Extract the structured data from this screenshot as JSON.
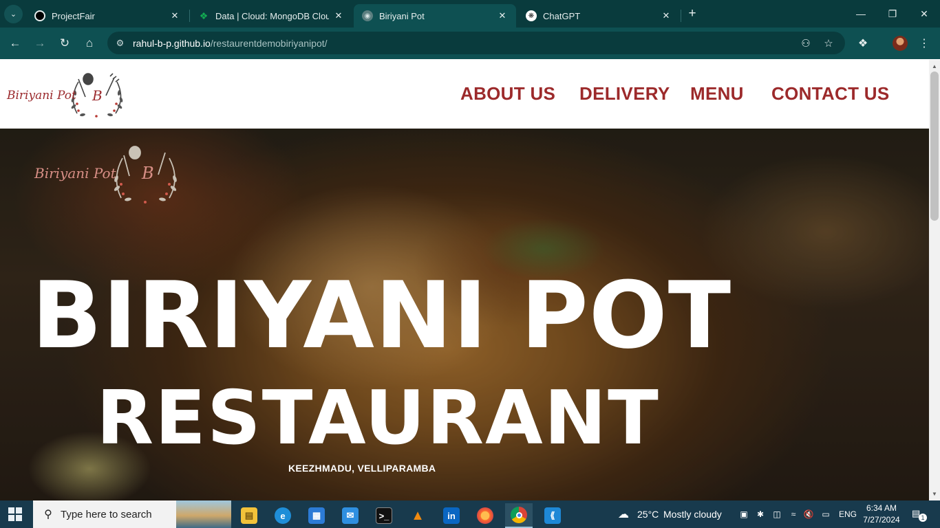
{
  "browser": {
    "tabs": [
      {
        "label": "ProjectFair",
        "icon": "github-icon"
      },
      {
        "label": "Data | Cloud: MongoDB Cloud",
        "icon": "mongodb-leaf-icon"
      },
      {
        "label": "Biriyani Pot",
        "icon": "site-favicon-icon"
      },
      {
        "label": "ChatGPT",
        "icon": "openai-icon"
      }
    ],
    "active_tab_index": 2,
    "url_host": "rahul-b-p.github.io",
    "url_path": "/restaurentdemobiriyanipot/"
  },
  "site": {
    "logo_text": "Biriyani Pot",
    "logo_mark": "B",
    "nav": [
      "ABOUT US",
      "DELIVERY",
      "MENU",
      "CONTACT US"
    ],
    "hero_logo_text": "Biriyani Pot",
    "hero_logo_mark": "B",
    "hero_title_line1": "BIRIYANI POT",
    "hero_title_line2": "RESTAURANT",
    "hero_subtitle": "KEEZHMADU, VELLIPARAMBA",
    "brand_color": "#9c2a2b"
  },
  "taskbar": {
    "search_placeholder": "Type here to search",
    "apps": [
      "file-explorer-icon",
      "edge-icon",
      "microsoft-store-icon",
      "mail-icon",
      "terminal-icon",
      "vlc-icon",
      "linkedin-icon",
      "firefox-icon",
      "chrome-icon",
      "vscode-icon"
    ],
    "weather_temp": "25°C",
    "weather_text": "Mostly cloudy",
    "language": "ENG",
    "time": "6:34 AM",
    "date": "7/27/2024",
    "notification_count": "1"
  }
}
